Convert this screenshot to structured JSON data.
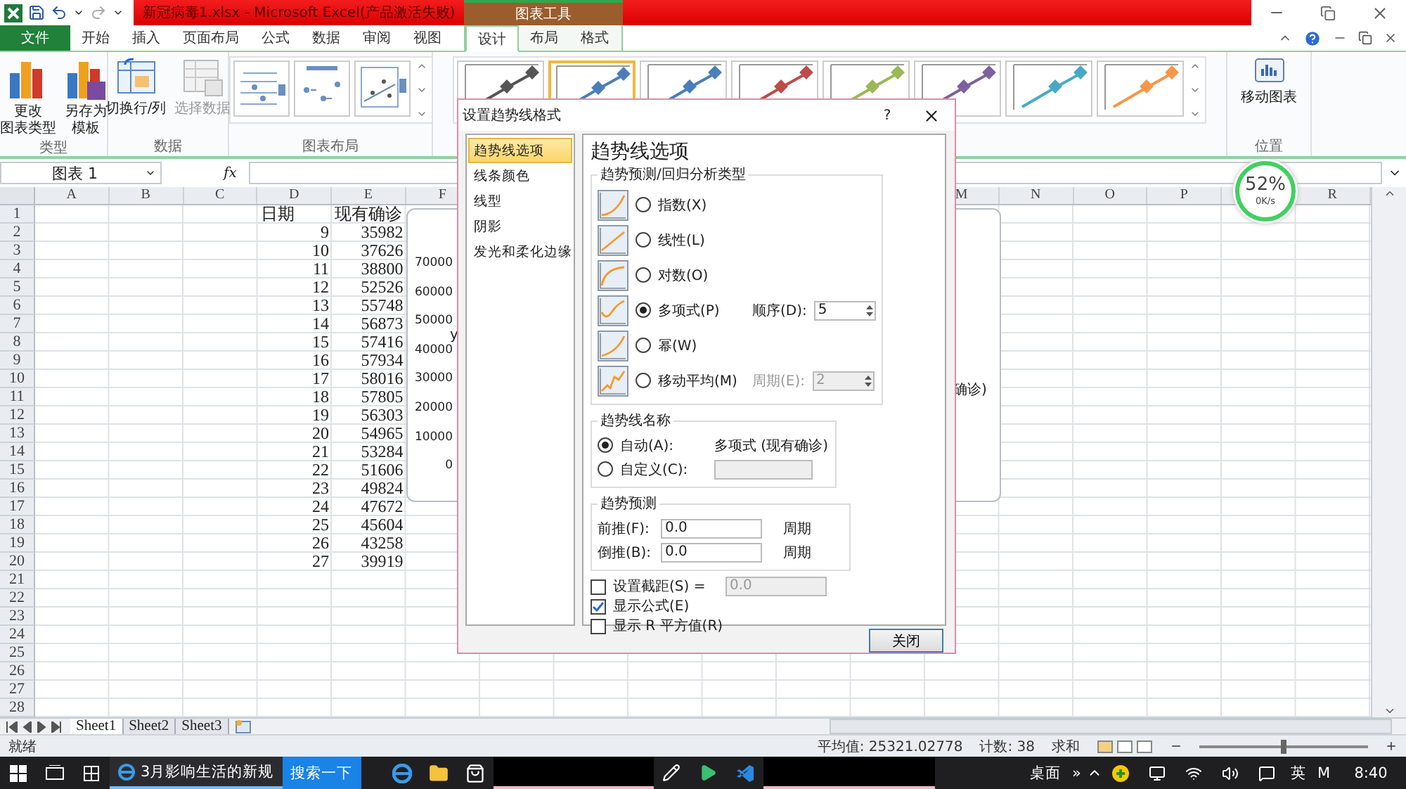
{
  "window": {
    "title": "新冠病毒1.xlsx - Microsoft Excel(产品激活失败)",
    "context_group": "图表工具"
  },
  "tabs": [
    {
      "label": "文件",
      "kind": "file",
      "selected": false
    },
    {
      "label": "开始",
      "kind": "normal",
      "selected": false
    },
    {
      "label": "插入",
      "kind": "normal",
      "selected": false
    },
    {
      "label": "页面布局",
      "kind": "normal",
      "selected": false
    },
    {
      "label": "公式",
      "kind": "normal",
      "selected": false
    },
    {
      "label": "数据",
      "kind": "normal",
      "selected": false
    },
    {
      "label": "审阅",
      "kind": "normal",
      "selected": false
    },
    {
      "label": "视图",
      "kind": "normal",
      "selected": false
    },
    {
      "label": "设计",
      "kind": "context",
      "selected": true
    },
    {
      "label": "布局",
      "kind": "context",
      "selected": false
    },
    {
      "label": "格式",
      "kind": "context",
      "selected": false
    }
  ],
  "ribbon": {
    "type_group": {
      "label": "类型",
      "buttons": [
        {
          "lines": [
            "更改",
            "图表类型"
          ],
          "kind": "change_type",
          "disabled": false
        },
        {
          "lines": [
            "另存为",
            "模板"
          ],
          "kind": "save_template",
          "disabled": false
        }
      ]
    },
    "data_group": {
      "label": "数据",
      "buttons": [
        {
          "lines": [
            "切换行/列"
          ],
          "kind": "switch",
          "disabled": false
        },
        {
          "lines": [
            "选择数据"
          ],
          "kind": "select",
          "disabled": true
        }
      ]
    },
    "layout_group": {
      "label": "图表布局",
      "layouts": [
        {
          "kind": "legend_right"
        },
        {
          "kind": "labels"
        },
        {
          "kind": "scatter"
        }
      ]
    },
    "styles": [
      {
        "color": "#555555",
        "selected": false
      },
      {
        "color": "#4a7ebb",
        "selected": true
      },
      {
        "color": "#4a7ebb",
        "selected": false
      },
      {
        "color": "#be4b48",
        "selected": false
      },
      {
        "color": "#98b954",
        "selected": false
      },
      {
        "color": "#7d60a0",
        "selected": false
      },
      {
        "color": "#46aac5",
        "selected": false
      },
      {
        "color": "#f79646",
        "selected": false
      }
    ],
    "position_group": {
      "label": "位置",
      "button": "移动图表"
    }
  },
  "formula_bar": {
    "name_box": "图表 1",
    "function_label": "fx"
  },
  "columns": [
    "A",
    "B",
    "C",
    "D",
    "E",
    "F",
    "M",
    "N",
    "O",
    "P",
    "R"
  ],
  "rows": [
    {
      "number": "1",
      "kind": "text",
      "column_d": "日期",
      "column_e": "现有确诊"
    },
    {
      "number": "2",
      "kind": "number",
      "column_d": "9",
      "column_e": "35982"
    },
    {
      "number": "3",
      "kind": "number",
      "column_d": "10",
      "column_e": "37626"
    },
    {
      "number": "4",
      "kind": "number",
      "column_d": "11",
      "column_e": "38800"
    },
    {
      "number": "5",
      "kind": "number",
      "column_d": "12",
      "column_e": "52526"
    },
    {
      "number": "6",
      "kind": "number",
      "column_d": "13",
      "column_e": "55748"
    },
    {
      "number": "7",
      "kind": "number",
      "column_d": "14",
      "column_e": "56873"
    },
    {
      "number": "8",
      "kind": "number",
      "column_d": "15",
      "column_e": "57416"
    },
    {
      "number": "9",
      "kind": "number",
      "column_d": "16",
      "column_e": "57934"
    },
    {
      "number": "10",
      "kind": "number",
      "column_d": "17",
      "column_e": "58016"
    },
    {
      "number": "11",
      "kind": "number",
      "column_d": "18",
      "column_e": "57805"
    },
    {
      "number": "12",
      "kind": "number",
      "column_d": "19",
      "column_e": "56303"
    },
    {
      "number": "13",
      "kind": "number",
      "column_d": "20",
      "column_e": "54965"
    },
    {
      "number": "14",
      "kind": "number",
      "column_d": "21",
      "column_e": "53284"
    },
    {
      "number": "15",
      "kind": "number",
      "column_d": "22",
      "column_e": "51606"
    },
    {
      "number": "16",
      "kind": "number",
      "column_d": "23",
      "column_e": "49824"
    },
    {
      "number": "17",
      "kind": "number",
      "column_d": "24",
      "column_e": "47672"
    },
    {
      "number": "18",
      "kind": "number",
      "column_d": "25",
      "column_e": "45604"
    },
    {
      "number": "19",
      "kind": "number",
      "column_d": "26",
      "column_e": "43258"
    },
    {
      "number": "20",
      "kind": "number",
      "column_d": "27",
      "column_e": "39919"
    },
    {
      "number": "21"
    },
    {
      "number": "22"
    },
    {
      "number": "23"
    },
    {
      "number": "24"
    },
    {
      "number": "25"
    },
    {
      "number": "26"
    },
    {
      "number": "27"
    },
    {
      "number": "28"
    }
  ],
  "chart": {
    "y_axis_labels": [
      "70000",
      "60000",
      "50000",
      "40000",
      "30000",
      "20000",
      "10000",
      "0"
    ],
    "equation_fragment": "y",
    "legend_fragment": "确诊)"
  },
  "sheet_tabs": [
    {
      "label": "Sheet1",
      "selected": true
    },
    {
      "label": "Sheet2",
      "selected": false
    },
    {
      "label": "Sheet3",
      "selected": false
    }
  ],
  "status_bar": {
    "ready": "就绪",
    "average": "平均值: 25321.02778",
    "count": "计数: 38",
    "sum": "求和",
    "zoom": {
      "level": 0.5
    }
  },
  "speed_widget": {
    "percent": "52%",
    "speed": "0K/s"
  },
  "dialog": {
    "title": "设置趋势线格式",
    "help": "?",
    "nav": [
      {
        "label": "趋势线选项",
        "selected": true
      },
      {
        "label": "线条颜色",
        "selected": false
      },
      {
        "label": "线型",
        "selected": false
      },
      {
        "label": "阴影",
        "selected": false
      },
      {
        "label": "发光和柔化边缘",
        "selected": false
      }
    ],
    "heading": "趋势线选项",
    "type_group": {
      "title": "趋势预测/回归分析类型",
      "options": [
        {
          "label": "指数(X)",
          "kind": "exponential",
          "selected": false
        },
        {
          "label": "线性(L)",
          "kind": "linear",
          "selected": false
        },
        {
          "label": "对数(O)",
          "kind": "logarithmic",
          "selected": false
        },
        {
          "label": "多项式(P)",
          "kind": "polynomial",
          "selected": true,
          "parameter": {
            "label": "顺序(D):",
            "value": "5",
            "disabled": false
          }
        },
        {
          "label": "幂(W)",
          "kind": "power",
          "selected": false
        },
        {
          "label": "移动平均(M)",
          "kind": "moving_average",
          "selected": false,
          "parameter": {
            "label": "周期(E):",
            "value": "2",
            "disabled": true
          }
        }
      ]
    },
    "name_group": {
      "title": "趋势线名称",
      "options": [
        {
          "label": "自动(A):",
          "selected": true,
          "value": "多项式 (现有确诊)"
        },
        {
          "label": "自定义(C):",
          "selected": false,
          "field_disabled": true
        }
      ]
    },
    "forecast_group": {
      "title": "趋势预测",
      "rows": [
        {
          "label": "前推(F):",
          "value": "0.0",
          "unit": "周期"
        },
        {
          "label": "倒推(B):",
          "value": "0.0",
          "unit": "周期"
        }
      ]
    },
    "checkboxes": [
      {
        "label": "设置截距(S) =",
        "checked": false,
        "field": {
          "value": "0.0",
          "disabled": true
        }
      },
      {
        "label": "显示公式(E)",
        "checked": true
      },
      {
        "label": "显示 R 平方值(R)",
        "checked": false
      }
    ],
    "close_button": "关闭"
  },
  "taskbar": {
    "window_button": "3月影响生活的新规",
    "search_button": "搜索一下",
    "desktop": "桌面",
    "more": "»",
    "input_language": "英",
    "ime_mode": "M",
    "time": "8:40"
  }
}
